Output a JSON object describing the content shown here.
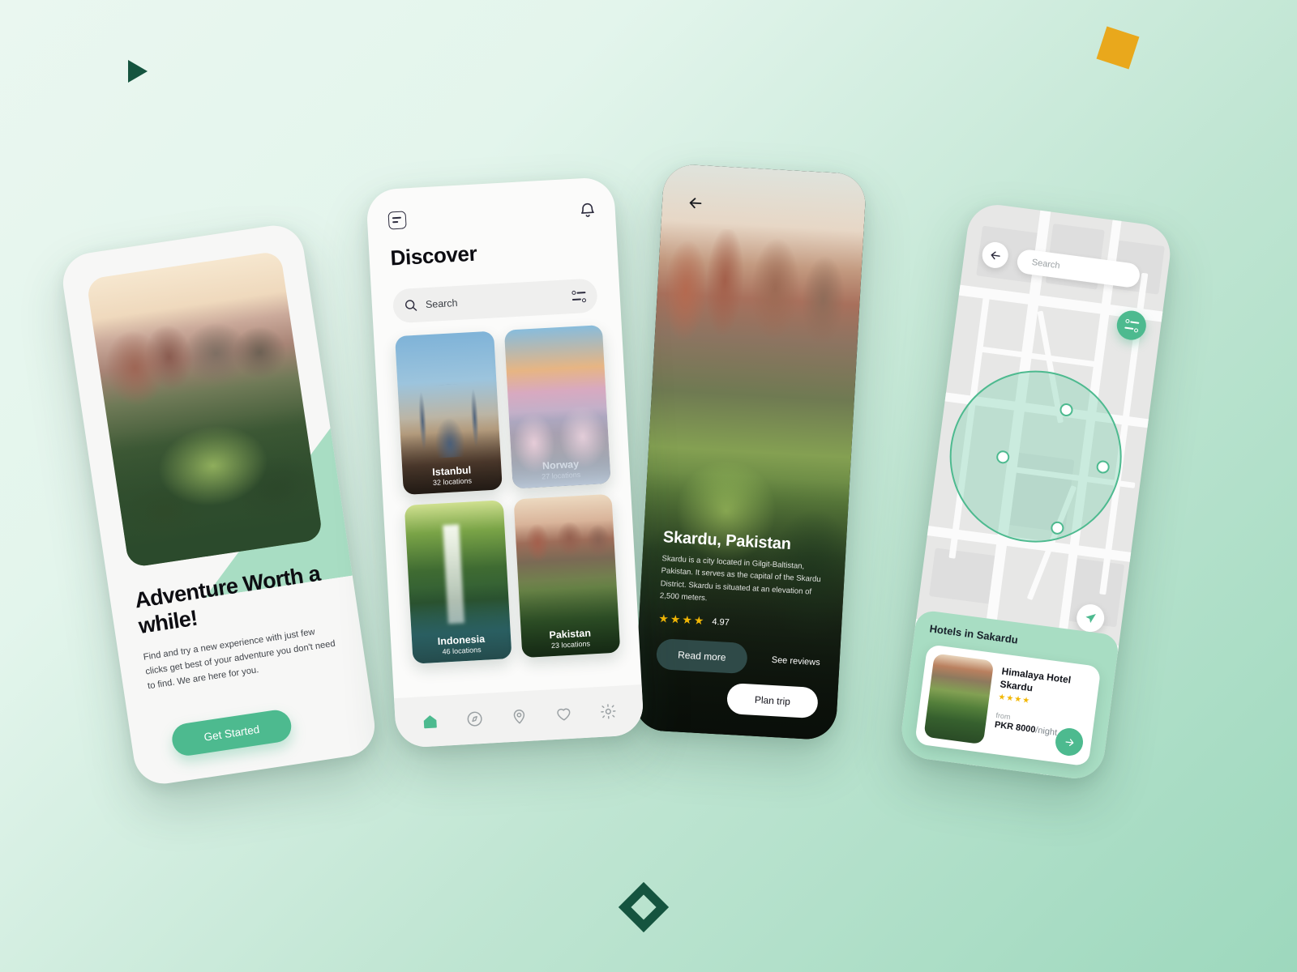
{
  "theme": {
    "accent_green": "#4dba8f",
    "mint": "#a8ddc3",
    "dark_green": "#15543f",
    "amber": "#e9a81c",
    "star_gold": "#f2b705",
    "dark_teal_button": "#2f4a48"
  },
  "decorations": [
    {
      "name": "triangle",
      "color": "#15543f"
    },
    {
      "name": "square",
      "color": "#e9a81c"
    },
    {
      "name": "diamond",
      "color": "#15543f"
    }
  ],
  "onboarding": {
    "title": "Adventure Worth a while!",
    "subtitle": "Find and try a new experience with just few clicks get best of your adventure you don't need to find. We are here for you.",
    "cta_label": "Get Started"
  },
  "discover": {
    "menu_icon": "note-list-icon",
    "bell_icon": "bell-icon",
    "title": "Discover",
    "search": {
      "placeholder": "Search",
      "value": "",
      "search_icon": "search-icon",
      "filter_icon": "filter-icon"
    },
    "destinations": [
      {
        "name": "Istanbul",
        "locations": "32 locations"
      },
      {
        "name": "Norway",
        "locations": "27 locations"
      },
      {
        "name": "Indonesia",
        "locations": "46 locations"
      },
      {
        "name": "Pakistan",
        "locations": "23 locations"
      }
    ],
    "nav": [
      {
        "name": "home",
        "icon": "home-icon",
        "active": true
      },
      {
        "name": "explore",
        "icon": "compass-icon",
        "active": false
      },
      {
        "name": "places",
        "icon": "location-pin-icon",
        "active": false
      },
      {
        "name": "saved",
        "icon": "heart-icon",
        "active": false
      },
      {
        "name": "settings",
        "icon": "gear-icon",
        "active": false
      }
    ]
  },
  "detail": {
    "back_icon": "arrow-left-icon",
    "title": "Skardu, Pakistan",
    "description": "Skardu is a city located in Gilgit-Baltistan, Pakistan. It serves as the capital of the Skardu District. Skardu is situated at an elevation of  2,500 meters.",
    "stars": "★★★★",
    "score": "4.97",
    "read_more_label": "Read more",
    "see_reviews_label": "See reviews",
    "plan_trip_label": "Plan trip"
  },
  "map": {
    "back_icon": "arrow-left-icon",
    "search": {
      "placeholder": "Search",
      "value": "",
      "search_icon": "search-icon",
      "filter_icon": "filter-icon"
    },
    "locate_icon": "navigation-arrow-icon",
    "panel_title": "Hotels in Sakardu",
    "hotel": {
      "name": "Himalaya Hotel Skardu",
      "stars": "★★★★",
      "from_label": "from",
      "price": "PKR 8000",
      "price_unit": "/night",
      "go_icon": "arrow-right-icon"
    },
    "pins_count": 4
  }
}
